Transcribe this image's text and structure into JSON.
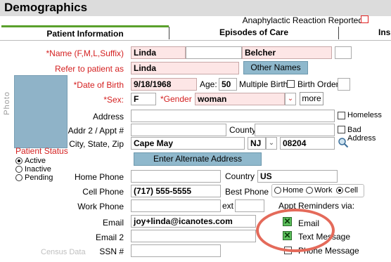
{
  "header": {
    "title": "Demographics",
    "anaphylactic_label": "Anaphylactic Reaction Reported"
  },
  "tabs": [
    {
      "label": "Patient Information"
    },
    {
      "label": "Episodes of Care"
    },
    {
      "label": "Ins"
    }
  ],
  "photo_label": "Photo",
  "census_label": "Census Data",
  "patient_status": {
    "title": "Patient Status",
    "options": [
      "Active",
      "Inactive",
      "Pending"
    ],
    "selected": "Active"
  },
  "labels": {
    "name": "*Name (F,M,L,Suffix)",
    "refer": "Refer to patient as",
    "dob": "*Date of Birth",
    "age": "Age:",
    "multiple_birth": "Multiple Birth",
    "birth_order": "Birth Order",
    "sex": "*Sex:",
    "gender": "*Gender",
    "address": "Address",
    "homeless": "Homeless",
    "addr2": "Addr 2 / Appt #",
    "county": "County",
    "bad_address": "Bad Address",
    "city_state_zip": "City, State, Zip",
    "home_phone": "Home Phone",
    "country": "Country",
    "cell_phone": "Cell Phone",
    "best_phone": "Best Phone",
    "work_phone": "Work Phone",
    "ext": "ext",
    "appt_reminders": "Appt Reminders via:",
    "email": "Email",
    "email2": "Email 2",
    "ssn": "SSN #"
  },
  "values": {
    "first_name": "Linda",
    "middle_name": "",
    "last_name": "Belcher",
    "suffix": "",
    "refer_as": "Linda",
    "dob": "9/18/1968",
    "age": "50",
    "birth_order": "",
    "sex": "F",
    "gender": "woman",
    "address": "",
    "addr2": "",
    "county": "",
    "city": "Cape May",
    "state": "NJ",
    "zip": "08204",
    "home_phone": "",
    "country": "US",
    "cell_phone": "(717) 555-5555",
    "work_phone": "",
    "ext": "",
    "email": "joy+linda@icanotes.com",
    "email2": "",
    "ssn": ""
  },
  "buttons": {
    "other_names": "Other Names",
    "more": "more",
    "enter_alt_address": "Enter Alternate Address"
  },
  "best_phone_options": [
    "Home",
    "Work",
    "Cell"
  ],
  "best_phone_selected": "Cell",
  "reminders": [
    {
      "label": "Email",
      "checked": true
    },
    {
      "label": "Text Message",
      "checked": true
    },
    {
      "label": "Phone Message",
      "checked": false
    }
  ],
  "colors": {
    "required_bg": "#fde6e6",
    "button_bg": "#8fb8cc",
    "active_tab": "#5aa02c",
    "required_text": "#d42020",
    "highlight_circle": "#e46a5a"
  }
}
